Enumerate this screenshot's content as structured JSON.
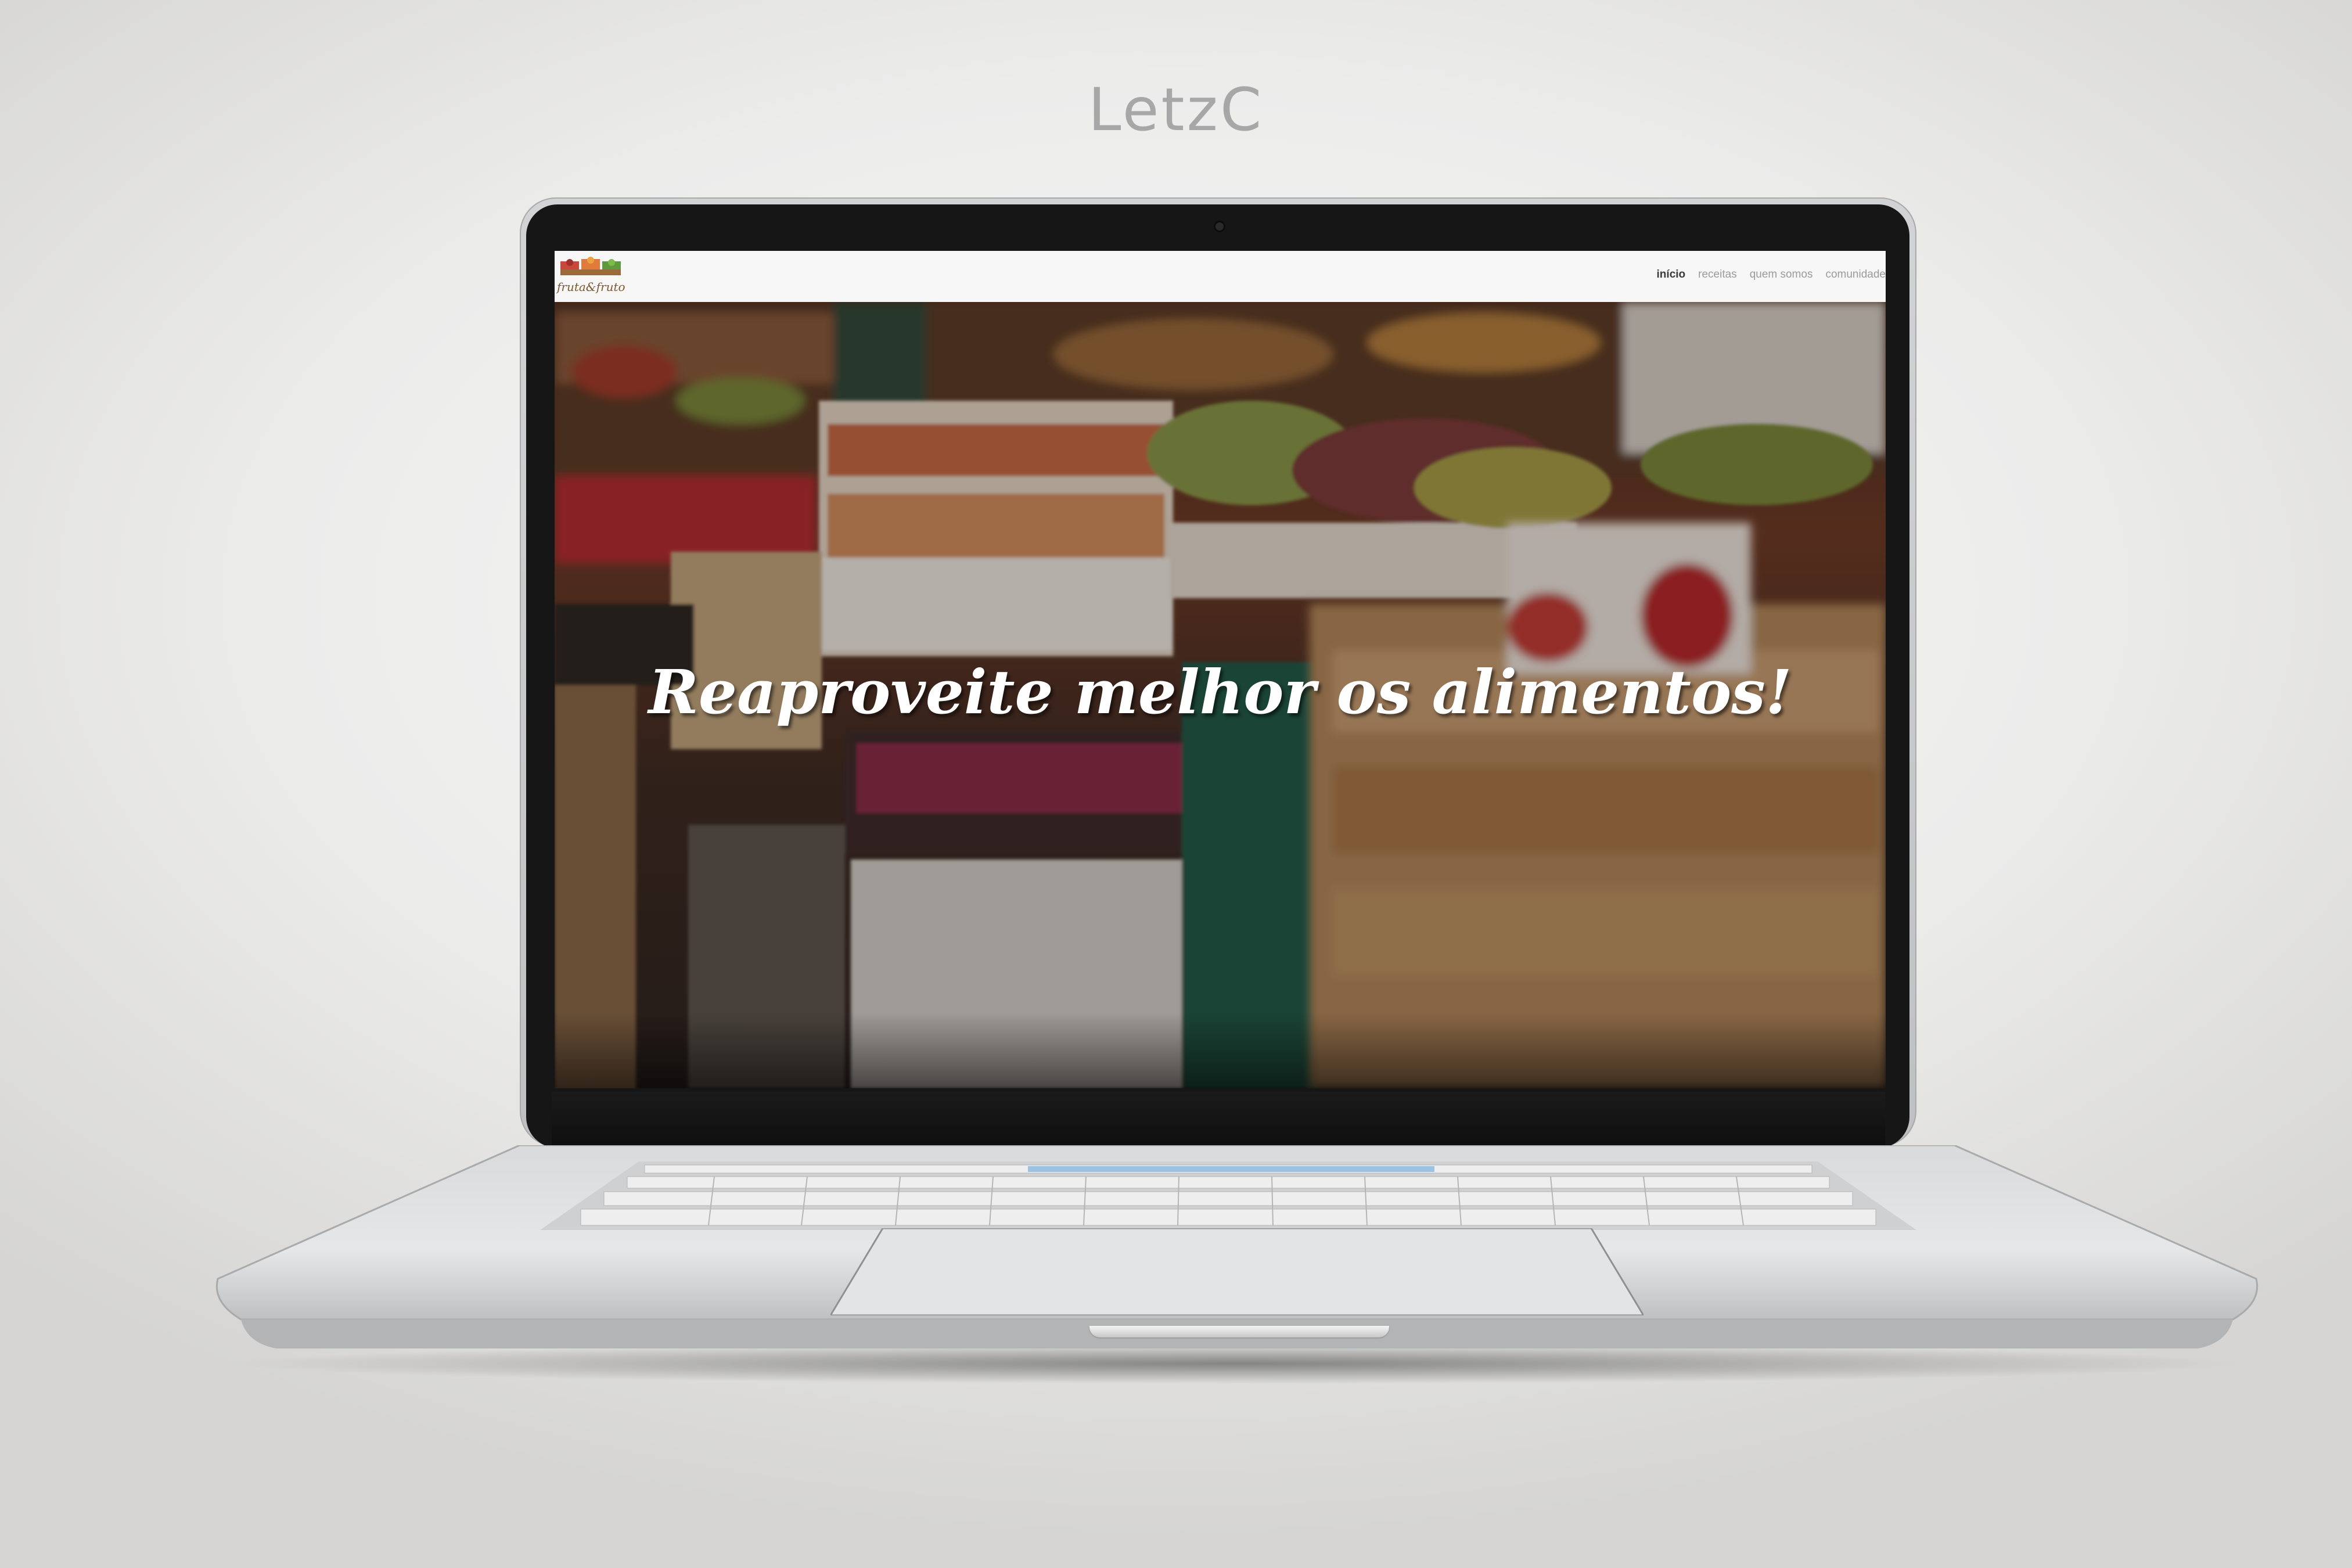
{
  "mockup": {
    "brand": "LetzC"
  },
  "site": {
    "logo_text": "fruta&fruto",
    "nav": [
      {
        "label": "início",
        "active": true
      },
      {
        "label": "receitas",
        "active": false
      },
      {
        "label": "quem somos",
        "active": false
      },
      {
        "label": "comunidade",
        "active": false
      }
    ],
    "hero": {
      "headline": "Reaproveite melhor os alimentos!",
      "background": "market fruit crates photo"
    }
  },
  "colors": {
    "background": "#ececeb",
    "laptop_frame": "#c9cacb",
    "bezel": "#161616",
    "nav_bg": "#f7f7f7",
    "nav_active": "#3a3a3a",
    "nav_inactive": "#9a9a9a",
    "hero_text": "#ffffff"
  },
  "icons": [
    "webcam-icon",
    "logo-crates-icon"
  ]
}
